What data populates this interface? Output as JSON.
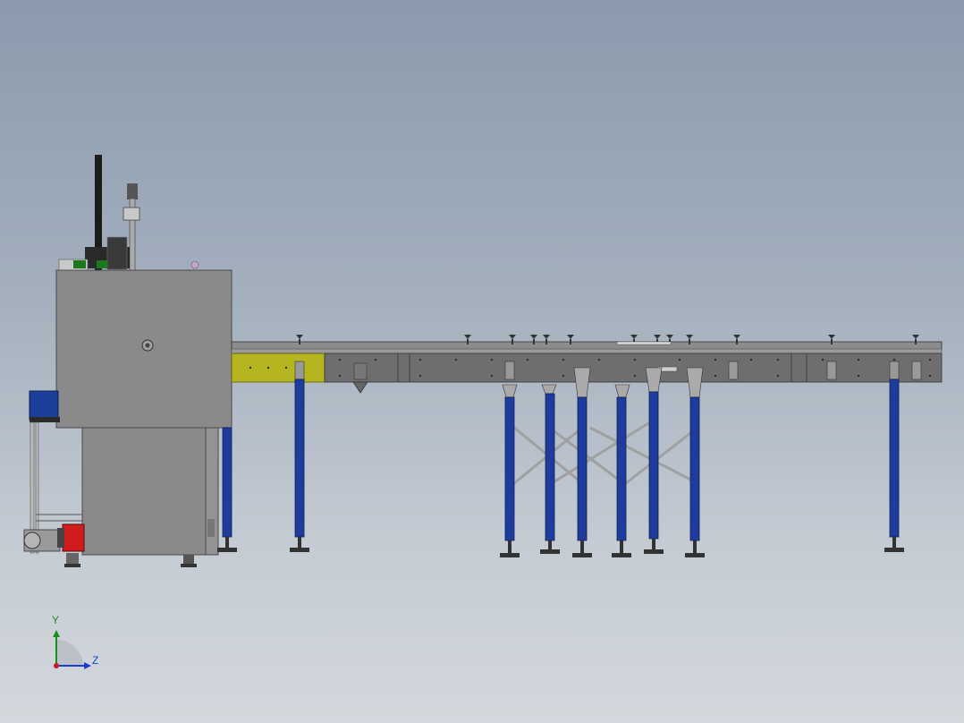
{
  "viewport": {
    "background_top": "#8b9aad",
    "background_bottom": "#d3d8dd"
  },
  "model": {
    "machine_body_color": "#8a8a8a",
    "conveyor_color": "#6e6e6e",
    "yellow_section_color": "#b5b520",
    "leg_color": "#1e3c9c",
    "motor_color": "#d01c1c"
  },
  "triad": {
    "y_label": "Y",
    "z_label": "Z",
    "y_color": "#1a8f1a",
    "z_color": "#1a3fcf",
    "x_color": "#c81e1e"
  }
}
